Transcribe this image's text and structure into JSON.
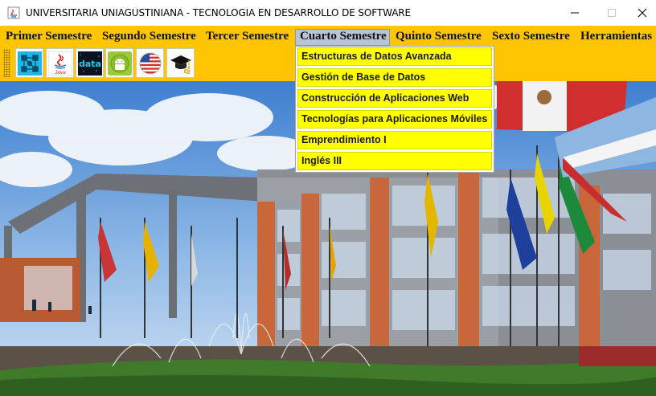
{
  "window": {
    "title": "UNIVERSITARIA UNIAGUSTINIANA - TECNOLOGIA EN DESARROLLO DE SOFTWARE"
  },
  "menu": {
    "items": [
      {
        "label": "Primer Semestre"
      },
      {
        "label": "Segundo Semestre"
      },
      {
        "label": "Tercer Semestre"
      },
      {
        "label": "Cuarto Semestre",
        "active": true
      },
      {
        "label": "Quinto Semestre"
      },
      {
        "label": "Sexto Semestre"
      },
      {
        "label": "Herramientas"
      }
    ]
  },
  "dropdown": {
    "items": [
      {
        "label": "Estructuras de Datos Avanzada"
      },
      {
        "label": "Gestión de Base de Datos"
      },
      {
        "label": "Construcción de Aplicaciones Web"
      },
      {
        "label": "Tecnologías para Aplicaciones Móviles"
      },
      {
        "label": "Emprendimiento I"
      },
      {
        "label": "Inglés III"
      }
    ]
  },
  "toolbar": {
    "buttons": [
      {
        "icon": "diagram-icon"
      },
      {
        "icon": "java-icon",
        "caption": "Java"
      },
      {
        "icon": "data-icon",
        "caption": "data"
      },
      {
        "icon": "android-icon"
      },
      {
        "icon": "us-flag-icon"
      },
      {
        "icon": "graduation-cap-icon"
      }
    ]
  },
  "colors": {
    "menubar": "#ffc500",
    "dropdown_item": "#ffff00",
    "active_menu": "#b7c4d6"
  }
}
